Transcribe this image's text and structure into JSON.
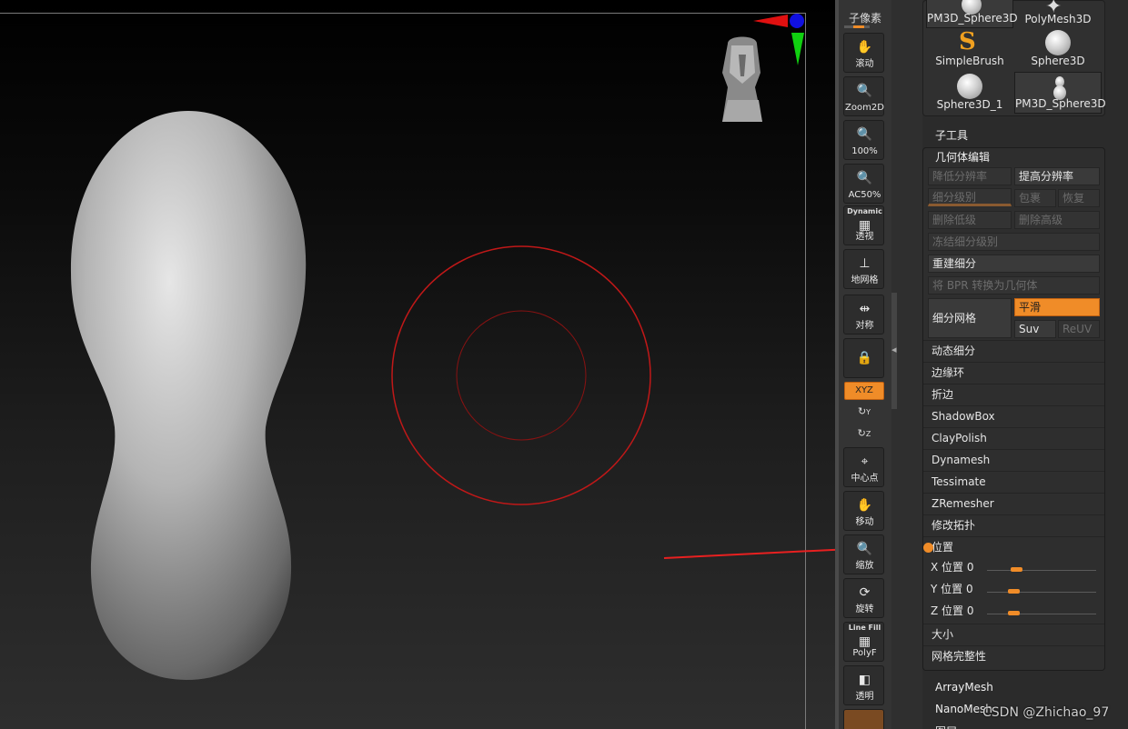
{
  "toolbar": {
    "top_label": "子像素",
    "buttons": [
      {
        "icon": "hand-icon",
        "label": "滚动"
      },
      {
        "icon": "zoom-icon",
        "label": "Zoom2D"
      },
      {
        "icon": "zoom-icon",
        "label": "100%"
      },
      {
        "icon": "zoom-icon",
        "label": "AC50%"
      },
      {
        "icon": "grid-icon",
        "top": "Dynamic",
        "label": "透视"
      },
      {
        "icon": "floor-grid-icon",
        "label": "地网格"
      },
      {
        "icon": "symmetry-icon",
        "label": "对称"
      },
      {
        "icon": "lock-icon",
        "label": ""
      },
      {
        "icon": "center-icon",
        "label": "中心点"
      },
      {
        "icon": "move-icon",
        "label": "移动"
      },
      {
        "icon": "scale-icon",
        "label": "缩放"
      },
      {
        "icon": "rotate-icon",
        "label": "旋转"
      },
      {
        "icon": "polyf-icon",
        "top": "Line Fill",
        "label": "PolyF"
      },
      {
        "icon": "transparency-icon",
        "label": "透明"
      }
    ],
    "xyz_label": "XYZ",
    "rot_y": "Y",
    "rot_z": "Z",
    "accent": "#f08c28"
  },
  "tools": [
    {
      "name": "PM3D_Sphere3D",
      "icon": "sphere-icon"
    },
    {
      "name": "PolyMesh3D",
      "icon": "star-icon"
    },
    {
      "name": "SimpleBrush",
      "icon": "simplebrush-s-icon"
    },
    {
      "name": "Sphere3D",
      "icon": "sphere-icon"
    },
    {
      "name": "Sphere3D_1",
      "icon": "sphere-icon"
    },
    {
      "name": "PM3D_Sphere3D",
      "icon": "bowling-pin-icon"
    }
  ],
  "panel": {
    "subtool": "子工具",
    "geometry": "几何体编辑",
    "lower_res": "降低分辨率",
    "higher_res": "提高分辨率",
    "sdiv": "细分级别",
    "reconstruct": "包裹",
    "restore": "恢复",
    "del_lower": "删除低级",
    "del_higher": "删除高级",
    "freeze": "冻结细分级别",
    "rebuild": "重建细分",
    "bpr": "将 BPR 转换为几何体",
    "divide": "细分网格",
    "smooth": "平滑",
    "suv": "Suv",
    "reuv": "ReUV",
    "sections": [
      "动态细分",
      "边缘环",
      "折边",
      "ShadowBox",
      "ClayPolish",
      "Dynamesh",
      "Tessimate",
      "ZRemesher",
      "修改拓扑"
    ],
    "position": "位置",
    "x_pos": {
      "label": "X 位置",
      "value": "0"
    },
    "y_pos": {
      "label": "Y 位置",
      "value": "0"
    },
    "z_pos": {
      "label": "Z 位置",
      "value": "0"
    },
    "size": "大小",
    "mesh_integrity": "网格完整性",
    "array_mesh": "ArrayMesh",
    "nano_mesh": "NanoMesh",
    "layers": "图层"
  },
  "watermark": "CSDN @Zhichao_97"
}
